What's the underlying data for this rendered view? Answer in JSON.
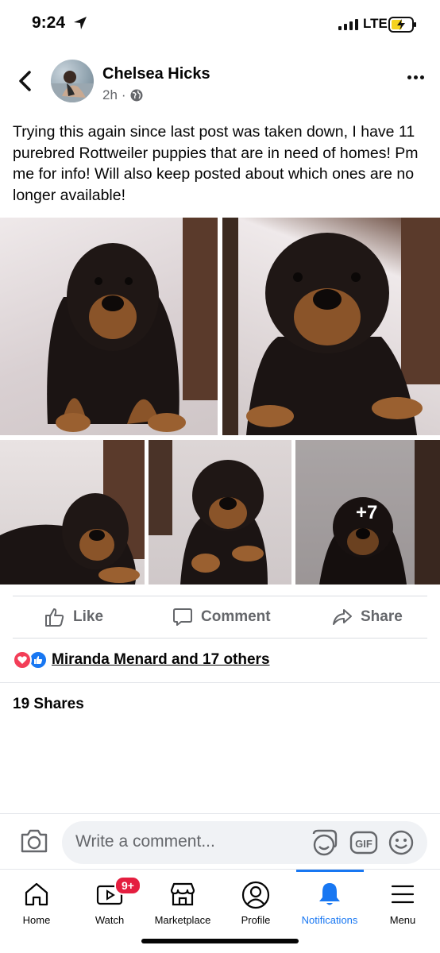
{
  "status_bar": {
    "time": "9:24",
    "network": "LTE"
  },
  "post": {
    "author": "Chelsea Hicks",
    "time_ago": "2h",
    "privacy_icon": "globe-icon",
    "text": "Trying this again since last post was taken down, I have 11 purebred Rottweiler puppies that are in need of homes! Pm me for info! Will also keep posted about which ones are no longer available!",
    "more_photos_count": "+7"
  },
  "actions": {
    "like": "Like",
    "comment": "Comment",
    "share": "Share"
  },
  "reactions": {
    "summary": "Miranda Menard and 17 others"
  },
  "shares": "19 Shares",
  "comment_box": {
    "placeholder": "Write a comment..."
  },
  "nav": {
    "active": "Notifications",
    "active_color": "#1877f2",
    "watch_badge": "9+",
    "items": [
      {
        "label": "Home",
        "icon": "home-icon"
      },
      {
        "label": "Watch",
        "icon": "watch-icon"
      },
      {
        "label": "Marketplace",
        "icon": "marketplace-icon"
      },
      {
        "label": "Profile",
        "icon": "profile-icon"
      },
      {
        "label": "Notifications",
        "icon": "bell-icon"
      },
      {
        "label": "Menu",
        "icon": "menu-icon"
      }
    ]
  }
}
